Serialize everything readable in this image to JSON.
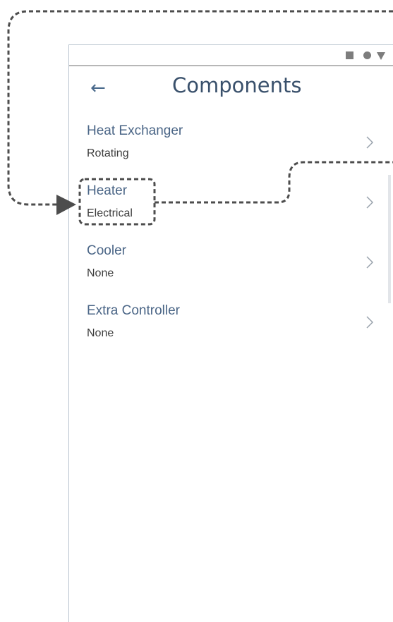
{
  "header": {
    "title": "Components",
    "back_icon": "arrow-left-icon"
  },
  "statusbar": {
    "icons": [
      "square-icon",
      "circle-icon",
      "triangle-down-icon"
    ]
  },
  "components": [
    {
      "title": "Heat Exchanger",
      "subtitle": "Rotating"
    },
    {
      "title": "Heater",
      "subtitle": "Electrical"
    },
    {
      "title": "Cooler",
      "subtitle": "None"
    },
    {
      "title": "Extra Controller",
      "subtitle": "None"
    }
  ],
  "colors": {
    "accent": "#4a6586",
    "title": "#39506b",
    "connector": "#4d4d4d"
  }
}
